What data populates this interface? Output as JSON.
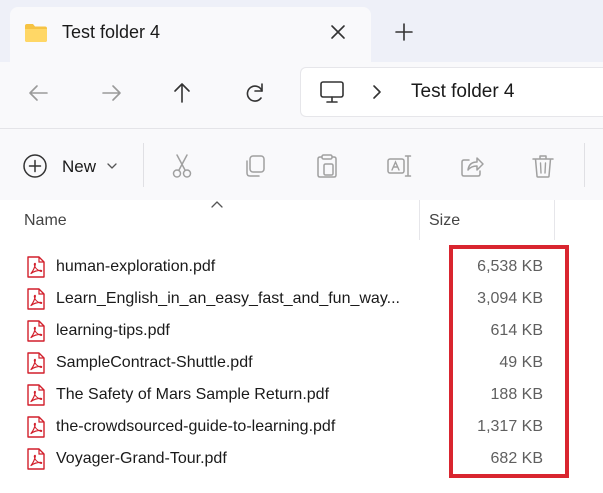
{
  "window": {
    "tab_title": "Test folder 4",
    "icons": {
      "tab_icon": "folder-icon",
      "close": "close-icon",
      "new_tab": "plus-icon"
    }
  },
  "navigation": {
    "icons": [
      "back-arrow-icon",
      "forward-arrow-icon",
      "up-arrow-icon",
      "refresh-icon"
    ],
    "address": {
      "root_icon": "computer-icon",
      "separator_icon": "chevron-right-icon",
      "current_folder": "Test folder 4"
    }
  },
  "commandbar": {
    "new_label": "New",
    "icons": [
      "cut-icon",
      "copy-icon",
      "paste-icon",
      "rename-icon",
      "share-icon",
      "delete-icon"
    ]
  },
  "columns": {
    "name": "Name",
    "size": "Size"
  },
  "files": [
    {
      "name": "human-exploration.pdf",
      "size": "6,538 KB"
    },
    {
      "name": "Learn_English_in_an_easy_fast_and_fun_way...",
      "size": "3,094 KB"
    },
    {
      "name": "learning-tips.pdf",
      "size": "614 KB"
    },
    {
      "name": "SampleContract-Shuttle.pdf",
      "size": "49 KB"
    },
    {
      "name": "The Safety of Mars Sample Return.pdf",
      "size": "188 KB"
    },
    {
      "name": "the-crowdsourced-guide-to-learning.pdf",
      "size": "1,317 KB"
    },
    {
      "name": "Voyager-Grand-Tour.pdf",
      "size": "682 KB"
    }
  ],
  "colors": {
    "accent_highlight": "#d9252f",
    "pdf_icon": "#d21f2b",
    "folder_icon": "#f6c343"
  }
}
